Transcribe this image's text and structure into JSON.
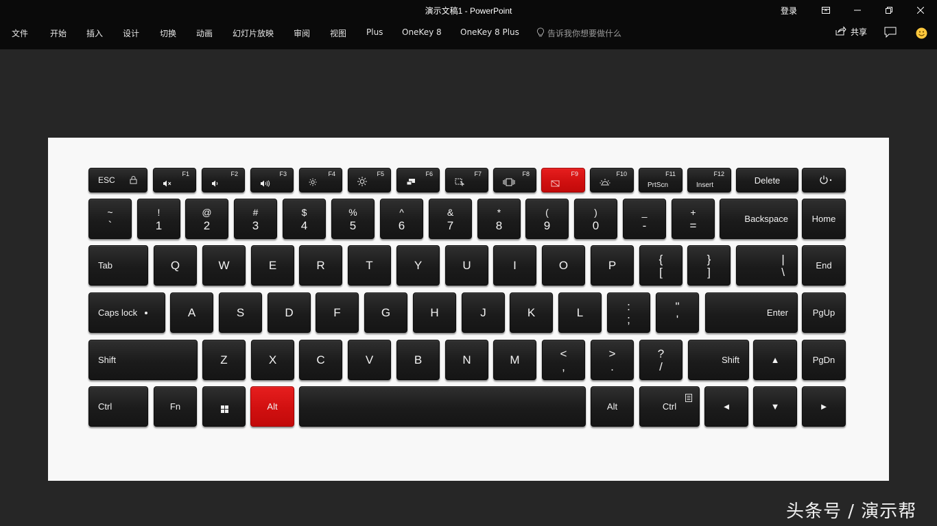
{
  "window": {
    "title": "演示文稿1  -  PowerPoint",
    "login_label": "登录"
  },
  "ribbon": {
    "tabs": [
      "文件",
      "开始",
      "插入",
      "设计",
      "切换",
      "动画",
      "幻灯片放映",
      "审阅",
      "视图",
      "Plus",
      "OneKey 8",
      "OneKey 8 Plus"
    ],
    "tell_me_placeholder": "告诉我你想要做什么",
    "share_label": "共享"
  },
  "keyboard": {
    "highlight_color": "#d91414",
    "highlighted_keys": [
      "F9",
      "Alt"
    ],
    "fn_row": {
      "esc": "ESC",
      "f_labels": [
        "F1",
        "F2",
        "F3",
        "F4",
        "F5",
        "F6",
        "F7",
        "F8",
        "F9",
        "F10",
        "F11",
        "F12"
      ],
      "f11_main": "PrtScn",
      "f12_main": "Insert",
      "delete": "Delete"
    },
    "number_row": [
      {
        "top": "~",
        "bot": "`"
      },
      {
        "top": "!",
        "bot": "1"
      },
      {
        "top": "@",
        "bot": "2"
      },
      {
        "top": "#",
        "bot": "3"
      },
      {
        "top": "$",
        "bot": "4"
      },
      {
        "top": "%",
        "bot": "5"
      },
      {
        "top": "^",
        "bot": "6"
      },
      {
        "top": "&",
        "bot": "7"
      },
      {
        "top": "*",
        "bot": "8"
      },
      {
        "top": "(",
        "bot": "9"
      },
      {
        "top": ")",
        "bot": "0"
      },
      {
        "top": "_",
        "bot": "-"
      },
      {
        "top": "+",
        "bot": "="
      }
    ],
    "backspace": "Backspace",
    "home": "Home",
    "tab": "Tab",
    "qwerty": [
      "Q",
      "W",
      "E",
      "R",
      "T",
      "Y",
      "U",
      "I",
      "O",
      "P"
    ],
    "brackets": [
      {
        "top": "{",
        "bot": "["
      },
      {
        "top": "}",
        "bot": "]"
      }
    ],
    "backslash": {
      "top": "|",
      "bot": "\\"
    },
    "end": "End",
    "caps": "Caps lock",
    "asdf": [
      "A",
      "S",
      "D",
      "F",
      "G",
      "H",
      "J",
      "K",
      "L"
    ],
    "semi": [
      {
        "top": ":",
        "bot": ";"
      },
      {
        "top": "\"",
        "bot": "'"
      }
    ],
    "enter": "Enter",
    "pgup": "PgUp",
    "shift": "Shift",
    "zxcv": [
      "Z",
      "X",
      "C",
      "V",
      "B",
      "N",
      "M"
    ],
    "punct": [
      {
        "top": "<",
        "bot": ","
      },
      {
        "top": ">",
        "bot": "."
      },
      {
        "top": "?",
        "bot": "/"
      }
    ],
    "up": "▲",
    "pgdn": "PgDn",
    "ctrl": "Ctrl",
    "fn": "Fn",
    "alt": "Alt",
    "left": "◄",
    "down": "▼",
    "right": "►"
  },
  "watermark": "头条号 / 演示帮"
}
